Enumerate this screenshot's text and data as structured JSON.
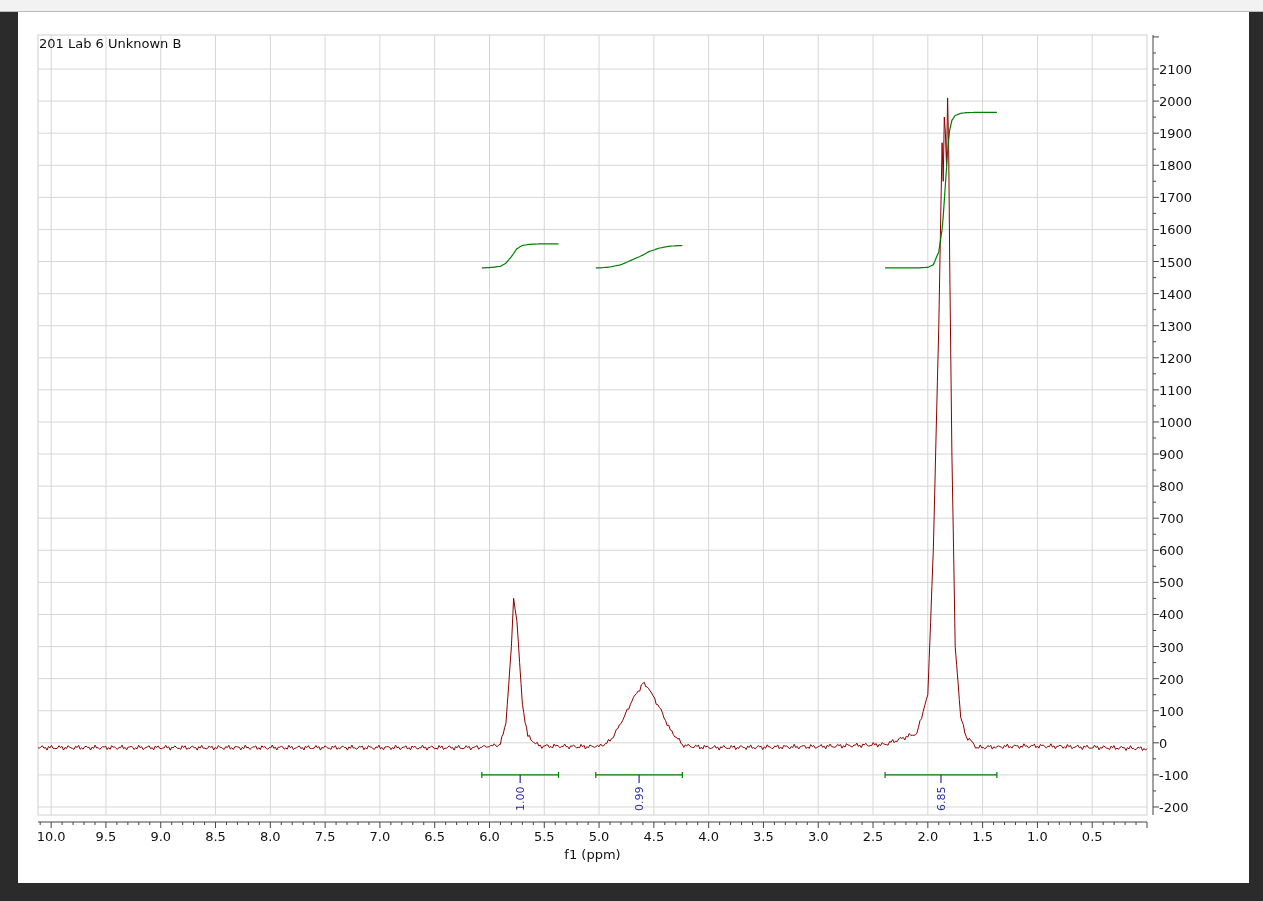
{
  "plot": {
    "chart_data": {
      "type": "line",
      "title": "201 Lab 6 Unknown B",
      "xlabel": "f1 (ppm)",
      "xlim": [
        10.12,
        0
      ],
      "ylim": [
        -225,
        2206
      ],
      "grid": true,
      "xticks": [
        {
          "value": 10,
          "label": "10.0"
        },
        {
          "value": 9.5,
          "label": "9.5"
        },
        {
          "value": 9,
          "label": "9.0"
        },
        {
          "value": 8.5,
          "label": "8.5"
        },
        {
          "value": 8,
          "label": "8.0"
        },
        {
          "value": 7.5,
          "label": "7.5"
        },
        {
          "value": 7,
          "label": "7.0"
        },
        {
          "value": 6.5,
          "label": "6.5"
        },
        {
          "value": 6,
          "label": "6.0"
        },
        {
          "value": 5.5,
          "label": "5.5"
        },
        {
          "value": 5,
          "label": "5.0"
        },
        {
          "value": 4.5,
          "label": "4.5"
        },
        {
          "value": 4,
          "label": "4.0"
        },
        {
          "value": 3.5,
          "label": "3.5"
        },
        {
          "value": 3,
          "label": "3.0"
        },
        {
          "value": 2.5,
          "label": "2.5"
        },
        {
          "value": 2,
          "label": "2.0"
        },
        {
          "value": 1.5,
          "label": "1.5"
        },
        {
          "value": 1,
          "label": "1.0"
        },
        {
          "value": 0.5,
          "label": "0.5"
        }
      ],
      "yticks": [
        -200,
        -100,
        0,
        100,
        200,
        300,
        400,
        500,
        600,
        700,
        800,
        900,
        1000,
        1100,
        1200,
        1300,
        1400,
        1500,
        1600,
        1700,
        1800,
        1900,
        2000,
        2100
      ],
      "x": [
        10.12,
        6.2,
        6.07,
        6.0,
        5.9,
        5.85,
        5.8,
        5.78,
        5.75,
        5.7,
        5.65,
        5.55,
        5.37,
        5.3,
        5.03,
        5.0,
        4.9,
        4.8,
        4.7,
        4.6,
        4.55,
        4.45,
        4.35,
        4.24,
        4.2,
        4.0,
        3.0,
        2.39,
        2.1,
        2.0,
        1.95,
        1.9,
        1.87,
        1.86,
        1.85,
        1.84,
        1.83,
        1.82,
        1.81,
        1.8,
        1.78,
        1.75,
        1.7,
        1.65,
        1.55,
        1.37,
        1.0,
        0
      ],
      "series": [
        {
          "color": "#8b0000",
          "values": [
            -15,
            -15,
            -14,
            -12,
            -5,
            60,
            300,
            450,
            380,
            120,
            20,
            -10,
            -11,
            -12,
            -12,
            -12,
            5,
            60,
            130,
            185,
            170,
            110,
            40,
            -5,
            -10,
            -15,
            -12,
            -5,
            30,
            150,
            600,
            1300,
            1870,
            1750,
            1950,
            1900,
            1800,
            2010,
            1850,
            1500,
            900,
            300,
            80,
            20,
            -15,
            -12,
            -10,
            -18
          ]
        },
        {
          "color": "#008000",
          "values": [
            null,
            null,
            1480,
            1481,
            1485,
            1495,
            1515,
            1525,
            1540,
            1550,
            1553,
            1555,
            1555,
            null,
            null,
            null,
            null,
            null,
            null,
            null,
            null,
            null,
            null,
            null,
            null,
            null,
            null,
            null,
            null,
            null,
            null,
            null,
            null,
            null,
            null,
            null,
            null,
            null,
            null,
            null,
            null,
            null,
            null,
            null,
            null,
            null,
            null,
            null
          ]
        },
        {
          "color": "#008000",
          "values": [
            null,
            null,
            null,
            null,
            null,
            null,
            null,
            null,
            null,
            null,
            null,
            null,
            null,
            null,
            1480,
            1480,
            1483,
            1490,
            1505,
            1520,
            1530,
            1542,
            1548,
            1550,
            null,
            null,
            null,
            null,
            null,
            null,
            null,
            null,
            null,
            null,
            null,
            null,
            null,
            null,
            null,
            null,
            null,
            null,
            null,
            null,
            null,
            null,
            null,
            null
          ]
        },
        {
          "color": "#008000",
          "values": [
            null,
            null,
            null,
            null,
            null,
            null,
            null,
            null,
            null,
            null,
            null,
            null,
            null,
            null,
            null,
            null,
            null,
            null,
            null,
            null,
            null,
            null,
            null,
            null,
            null,
            null,
            null,
            1480,
            1480,
            1482,
            1490,
            1530,
            1600,
            1640,
            1690,
            1740,
            1790,
            1840,
            1880,
            1910,
            1940,
            1955,
            1962,
            1964,
            1965,
            1965,
            null,
            null
          ]
        }
      ],
      "annotations": [
        "1.00",
        "0.99",
        "6.85"
      ]
    }
  }
}
